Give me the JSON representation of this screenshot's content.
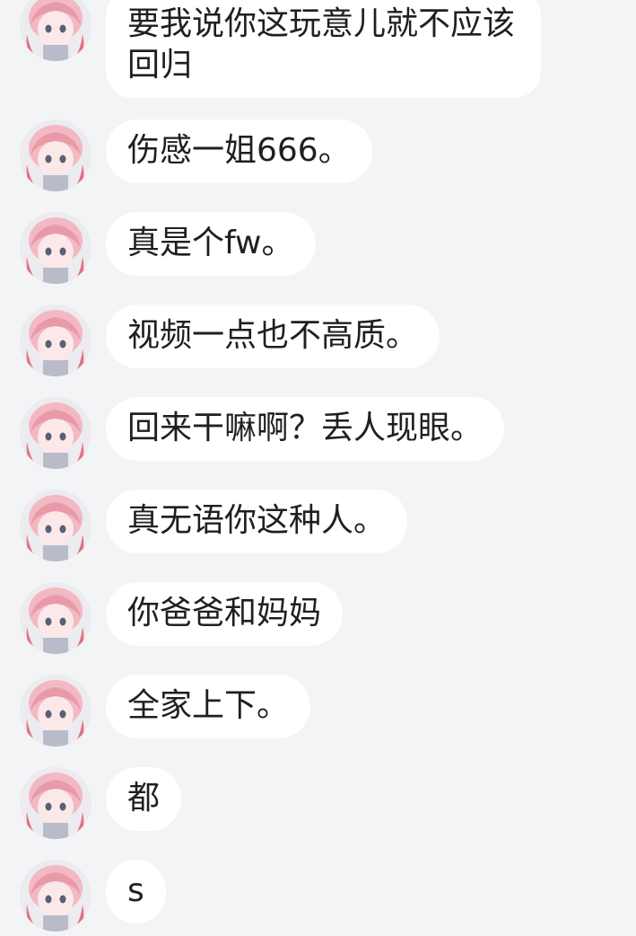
{
  "messages": [
    {
      "text": "要我说你这玩意儿就不应该回归"
    },
    {
      "text": "伤感一姐666。"
    },
    {
      "text": "真是个fw。"
    },
    {
      "text": "视频一点也不高质。"
    },
    {
      "text": "回来干嘛啊？丢人现眼。"
    },
    {
      "text": "真无语你这种人。"
    },
    {
      "text": "你爸爸和妈妈"
    },
    {
      "text": "全家上下。"
    },
    {
      "text": "都"
    },
    {
      "text": "s"
    }
  ]
}
